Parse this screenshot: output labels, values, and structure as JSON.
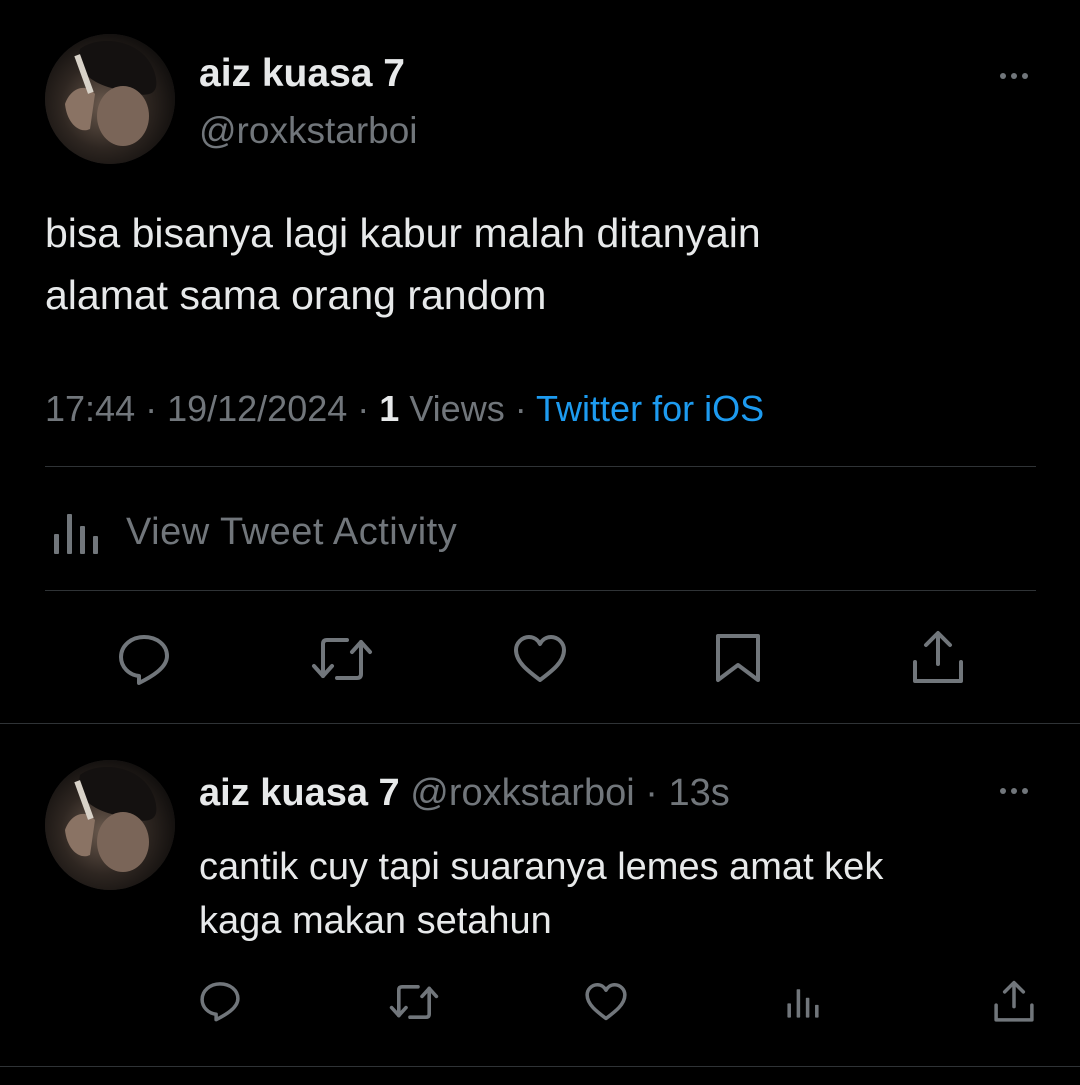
{
  "main_tweet": {
    "author": {
      "display_name": "aiz kuasa 7",
      "handle": "@roxkstarboi",
      "avatar": "avatar-photo"
    },
    "text_lines": [
      "bisa bisanya lagi kabur malah ditanyain",
      "alamat sama orang random"
    ],
    "meta": {
      "time": "17:44",
      "sep1": " · ",
      "date": "19/12/2024",
      "sep2": " · ",
      "views_count": "1",
      "views_label": " Views",
      "sep3": " · ",
      "source": "Twitter for iOS"
    },
    "activity": {
      "icon": "analytics-icon",
      "label": "View Tweet Activity"
    },
    "actions": [
      "reply-icon",
      "retweet-icon",
      "like-icon",
      "bookmark-icon",
      "share-icon"
    ]
  },
  "reply": {
    "author": {
      "display_name": "aiz kuasa 7",
      "handle": "@roxkstarboi",
      "separator": " · ",
      "time": "13s",
      "avatar": "avatar-photo"
    },
    "text_lines": [
      "cantik cuy tapi suaranya lemes amat kek",
      "kaga makan setahun"
    ],
    "actions": [
      "reply-icon",
      "retweet-icon",
      "like-icon",
      "analytics-icon",
      "share-icon"
    ]
  },
  "colors": {
    "background": "#000000",
    "text_primary": "#e7e9ea",
    "text_secondary": "#71767b",
    "link": "#1d9bf0",
    "divider": "#2f3336"
  }
}
